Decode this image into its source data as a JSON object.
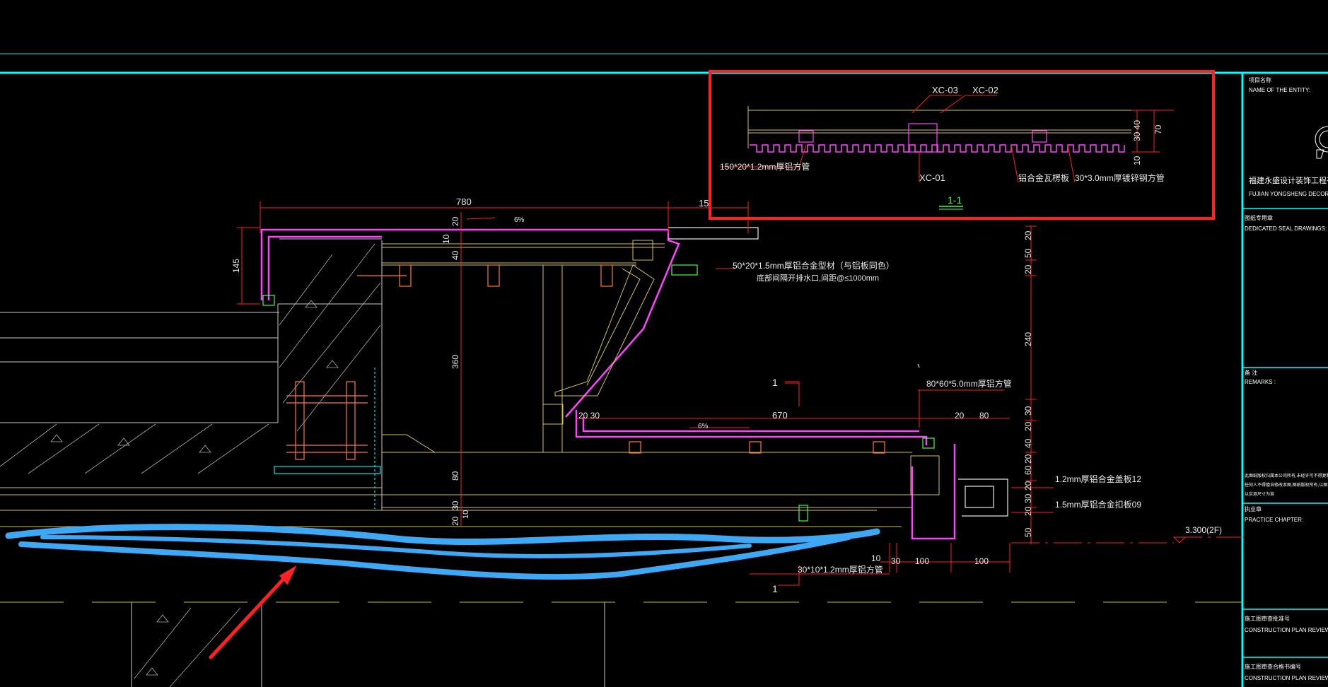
{
  "detail": {
    "label_xc03": "XC-03",
    "label_xc02": "XC-02",
    "label_xc01": "XC-01",
    "label_tube150": "150*20*1.2mm厚铝方管",
    "label_tile": "铝合金瓦楞板",
    "label_tube30": "30*3.0mm厚镀锌钢方管",
    "dim_30_40": "30  40",
    "dim_70": "70",
    "dim_10": "10",
    "section_title": "1-1"
  },
  "dims": {
    "d780": "780",
    "d15": "15",
    "d20a": "20",
    "slope_top": "6%",
    "d10a": "10",
    "d40a": "40",
    "d145": "145",
    "d360": "360",
    "d80a": "80",
    "d30a": "30",
    "d20b": "20",
    "d10b": "10",
    "d20_30": "20  30",
    "d670": "670",
    "slope_mid": "6%",
    "d20c": "20",
    "d80b": "80",
    "r20": "20",
    "r50": "50",
    "r20b": "20",
    "r240": "240",
    "r30": "30",
    "r20c": "20",
    "r40": "40",
    "r20d": "20",
    "r60": "60",
    "r20e": "20",
    "r30b": "30",
    "r20f": "20",
    "r50b": "50",
    "b10": "10",
    "b30": "30",
    "b100a": "100",
    "b100b": "100",
    "elev": "3.300(2F)"
  },
  "callouts": {
    "c1": "50*20*1.5mm厚铝合金型材（与铝板同色）",
    "c2": "底部间隔开排水口,间距@≤1000mm",
    "c3": "80*60*5.0mm厚铝方管",
    "c4": "1.2mm厚铝合金盖板12",
    "c5": "1.5mm厚铝合金扣板09",
    "c6": "30*10*1.2mm厚铝方管",
    "sec_mark_top": "1",
    "sec_mark_bottom": "1"
  },
  "title_block": {
    "entity_cn": "项目名称",
    "entity_en": "NAME OF THE ENTITY:",
    "company_cn": "福建永盛设计装饰工程有限公",
    "company_en": "FUJIAN  YONGSHENG  DECORA",
    "seal_cn": "图纸专用章",
    "seal_en": "DEDICATED SEAL DRAWINGS:",
    "remarks_cn": "备  注",
    "remarks_en": "REMARKS :",
    "note_cn1": "此图纸版权归属本公司所有,未经许可不得复制或用于他",
    "note_cn2": "任何人不得擅自修改本图,图纸版权所有,以图示尺寸为",
    "note_cn3": "以实测尺寸为准",
    "practice_cn": "执业章",
    "practice_en": "PRACTICE CHAPTER:",
    "review_cn": "施工图审查批准号",
    "review_en": "CONSTRUCTION PLAN REVIEW AP",
    "review2_cn": "施工图审查合格书编号",
    "review2_en": "CONSTRUCTION PLAN REVIEW CE"
  },
  "colors": {
    "background": "#000000",
    "frame_cyan": "#00ffff",
    "dim_red": "#ff0000",
    "profile_magenta": "#ff44ff",
    "wall_white": "#d8d8d8",
    "concrete_yellow": "#d4c05a",
    "annotation_blue": "#3ea8f5",
    "highlight_red": "#ff2222"
  }
}
